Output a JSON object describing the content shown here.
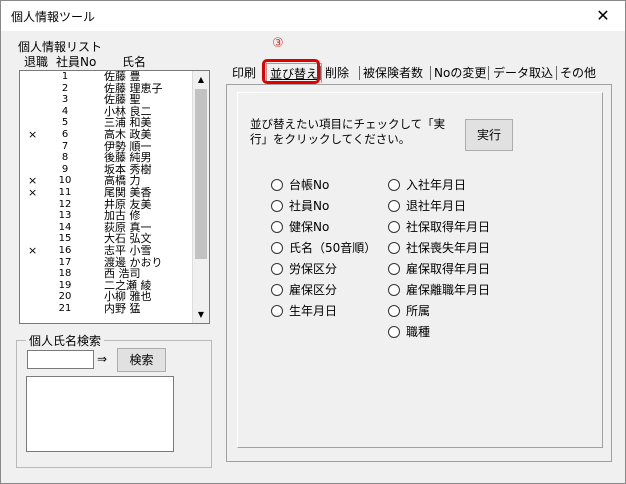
{
  "window": {
    "title": "個人情報ツール",
    "close_glyph": "✕"
  },
  "list": {
    "group_label": "個人情報リスト",
    "headers": {
      "retired": "退職",
      "employee_no": "社員No",
      "name": "氏名"
    },
    "rows": [
      {
        "mark": "",
        "num": "1",
        "name": "佐藤 豊"
      },
      {
        "mark": "",
        "num": "2",
        "name": "佐藤 理恵子"
      },
      {
        "mark": "",
        "num": "3",
        "name": "佐藤 聖"
      },
      {
        "mark": "",
        "num": "4",
        "name": "小林 良二"
      },
      {
        "mark": "",
        "num": "5",
        "name": "三浦 和美"
      },
      {
        "mark": "×",
        "num": "6",
        "name": "高木 政美"
      },
      {
        "mark": "",
        "num": "7",
        "name": "伊勢 順一"
      },
      {
        "mark": "",
        "num": "8",
        "name": "後藤 純男"
      },
      {
        "mark": "",
        "num": "9",
        "name": "坂本 秀樹"
      },
      {
        "mark": "×",
        "num": "10",
        "name": "高橋 力"
      },
      {
        "mark": "×",
        "num": "11",
        "name": "尾関 美香"
      },
      {
        "mark": "",
        "num": "12",
        "name": "井原 友美"
      },
      {
        "mark": "",
        "num": "13",
        "name": "加古 修"
      },
      {
        "mark": "",
        "num": "14",
        "name": "荻原 真一"
      },
      {
        "mark": "",
        "num": "15",
        "name": "大石 弘文"
      },
      {
        "mark": "×",
        "num": "16",
        "name": "志平 小雪"
      },
      {
        "mark": "",
        "num": "17",
        "name": "渡邊 かおり"
      },
      {
        "mark": "",
        "num": "18",
        "name": "西 浩司"
      },
      {
        "mark": "",
        "num": "19",
        "name": "二之瀬 綾"
      },
      {
        "mark": "",
        "num": "20",
        "name": "小柳 雅也"
      },
      {
        "mark": "",
        "num": "21",
        "name": "内野 猛"
      }
    ],
    "scroll_up_glyph": "▲",
    "scroll_down_glyph": "▼"
  },
  "search": {
    "group_label": "個人氏名検索",
    "input_value": "",
    "arrow_glyph": "⇒",
    "button_label": "検索"
  },
  "annotation": {
    "number": "③"
  },
  "tabs": [
    {
      "label": "印刷"
    },
    {
      "label": "並び替え"
    },
    {
      "label": "削除"
    },
    {
      "label": "被保険者数"
    },
    {
      "label": "Noの変更"
    },
    {
      "label": "データ取込"
    },
    {
      "label": "その他"
    }
  ],
  "sort_panel": {
    "instruction": "並び替えたい項目にチェックして「実行」をクリックしてください。",
    "execute_label": "実行",
    "left_options": [
      "台帳No",
      "社員No",
      "健保No",
      "氏名（50音順）",
      "労保区分",
      "雇保区分",
      "生年月日"
    ],
    "right_options": [
      "入社年月日",
      "退社年月日",
      "社保取得年月日",
      "社保喪失年月日",
      "雇保取得年月日",
      "雇保離職年月日",
      "所属",
      "職種"
    ]
  },
  "colors": {
    "highlight": "#e00000",
    "annotation": "#e03030"
  }
}
